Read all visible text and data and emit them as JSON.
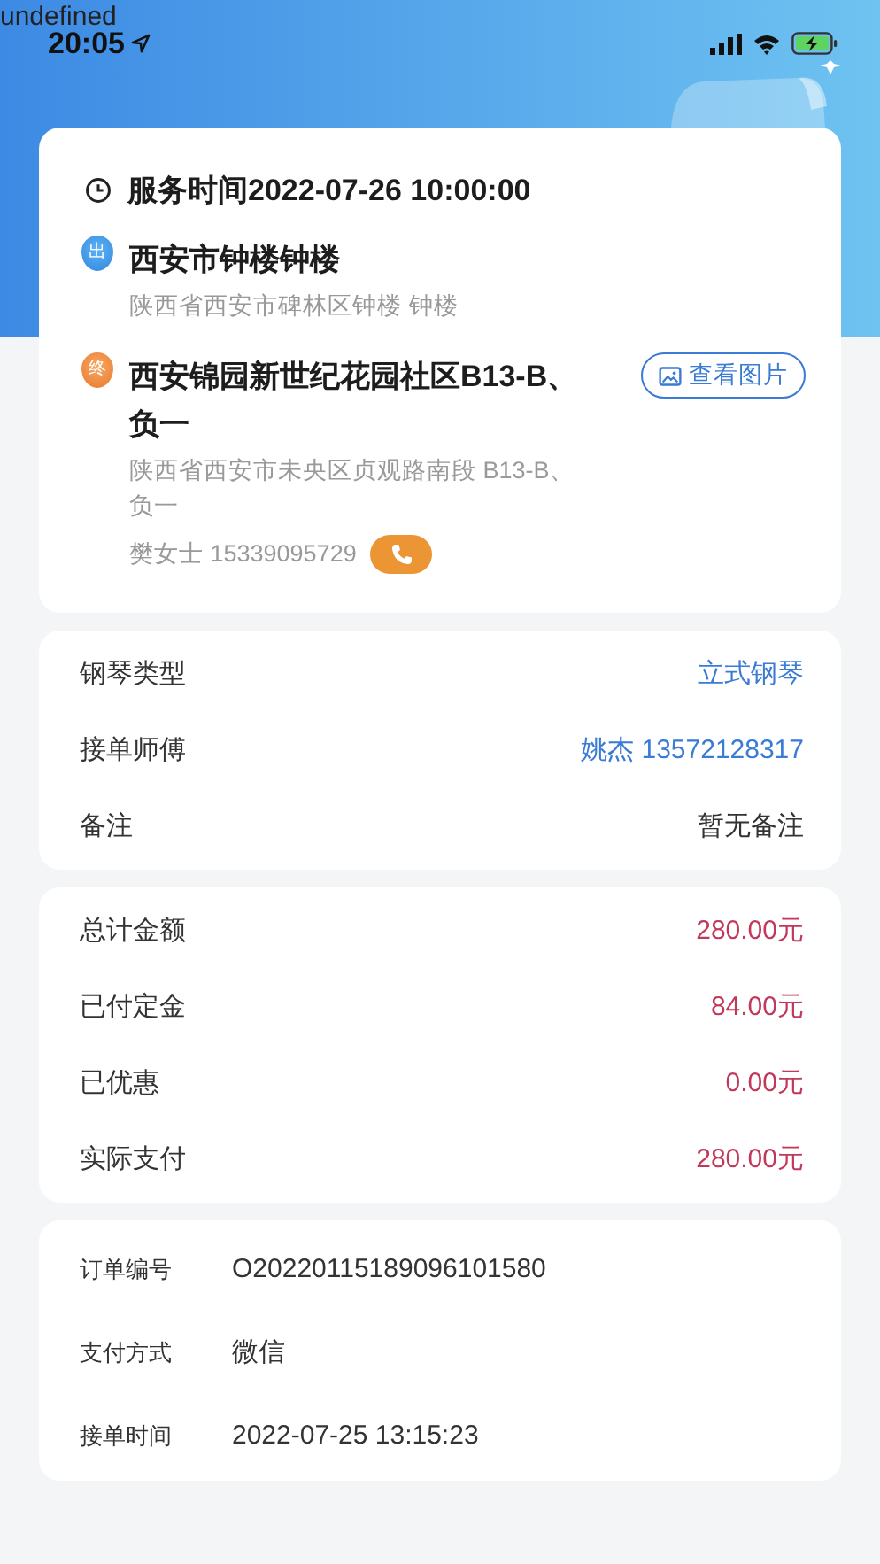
{
  "status_bar": {
    "overlay_text": "undefined",
    "time": "20:05"
  },
  "service": {
    "time_label": "服务时间2022-07-26 10:00:00"
  },
  "start": {
    "badge": "出",
    "name": "西安市钟楼钟楼",
    "address": "陕西省西安市碑林区钟楼 钟楼"
  },
  "end": {
    "badge": "终",
    "name": "西安锦园新世纪花园社区B13-B、负一",
    "address": "陕西省西安市未央区贞观路南段 B13-B、负一",
    "contact": "樊女士 15339095729",
    "photo_button": "查看图片"
  },
  "details": [
    {
      "label": "钢琴类型",
      "value": "立式钢琴",
      "kind": "link"
    },
    {
      "label": "接单师傅",
      "value": "姚杰 13572128317",
      "kind": "link"
    },
    {
      "label": "备注",
      "value": "暂无备注",
      "kind": "plain"
    }
  ],
  "payment": [
    {
      "label": "总计金额",
      "value": "280.00元"
    },
    {
      "label": "已付定金",
      "value": "84.00元"
    },
    {
      "label": "已优惠",
      "value": "0.00元"
    },
    {
      "label": "实际支付",
      "value": "280.00元"
    }
  ],
  "order_info": [
    {
      "label": "订单编号",
      "value": "O20220115189096101580"
    },
    {
      "label": "支付方式",
      "value": "微信"
    },
    {
      "label": "接单时间",
      "value": "2022-07-25 13:15:23"
    }
  ]
}
